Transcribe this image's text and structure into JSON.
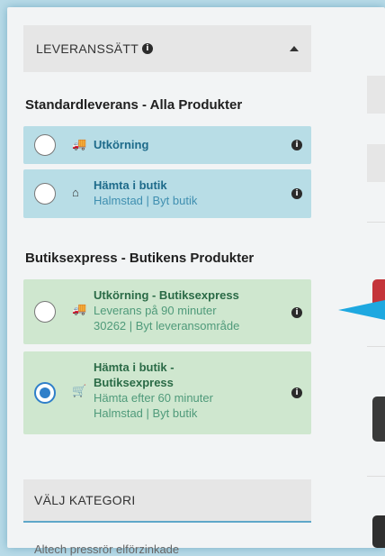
{
  "delivery": {
    "header": "LEVERANSSÄTT",
    "info_icon": "info-icon",
    "collapse_icon": "caret-up-icon",
    "standard": {
      "title": "Standardleverans - Alla Produkter",
      "options": [
        {
          "icon": "truck-icon",
          "name": "Utkörning",
          "sub1": "",
          "sub2": ""
        },
        {
          "icon": "home-icon",
          "name": "Hämta i butik",
          "sub1": "Halmstad | Byt butik",
          "sub2": ""
        }
      ]
    },
    "express": {
      "title": "Butiksexpress - Butikens Produkter",
      "options": [
        {
          "icon": "fast-truck-icon",
          "name": "Utkörning - Butiksexpress",
          "sub1": "Leverans på 90 minuter",
          "sub2": "30262 | Byt leveransområde"
        },
        {
          "icon": "cart-icon",
          "name_line1": "Hämta i butik -",
          "name_line2": "Butiksexpress",
          "sub1": "Hämta efter 60 minuter",
          "sub2": "Halmstad | Byt butik"
        }
      ]
    }
  },
  "categories": {
    "header": "VÄLJ KATEGORI",
    "items": [
      "Altech pressrör elförzinkade"
    ]
  },
  "colors": {
    "standard_bg": "#b8dde6",
    "express_bg": "#cfe7cf",
    "accent": "#2f7fc9",
    "pointer": "#1ea8e0"
  }
}
